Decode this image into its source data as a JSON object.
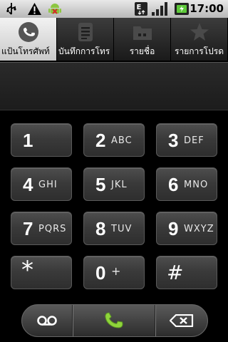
{
  "status_bar": {
    "time": "17:00",
    "icons": [
      "usb-icon",
      "warning-icon",
      "android-debug-icon",
      "data-transfer-icon",
      "signal-icon",
      "battery-charging-icon"
    ]
  },
  "tabs": [
    {
      "label": "แป้นโทรศัพท์",
      "icon": "phone-icon",
      "active": true
    },
    {
      "label": "บันทึกการโทร",
      "icon": "call-log-icon",
      "active": false
    },
    {
      "label": "รายชื่อ",
      "icon": "contacts-icon",
      "active": false
    },
    {
      "label": "รายการโปรด",
      "icon": "star-icon",
      "active": false
    }
  ],
  "digits_display": {
    "value": ""
  },
  "keypad": [
    {
      "digit": "1",
      "letters": ""
    },
    {
      "digit": "2",
      "letters": "ABC"
    },
    {
      "digit": "3",
      "letters": "DEF"
    },
    {
      "digit": "4",
      "letters": "GHI"
    },
    {
      "digit": "5",
      "letters": "JKL"
    },
    {
      "digit": "6",
      "letters": "MNO"
    },
    {
      "digit": "7",
      "letters": "PQRS"
    },
    {
      "digit": "8",
      "letters": "TUV"
    },
    {
      "digit": "9",
      "letters": "WXYZ"
    },
    {
      "digit": "*",
      "letters": ""
    },
    {
      "digit": "0",
      "letters": "+"
    },
    {
      "digit": "#",
      "letters": ""
    }
  ],
  "actions": {
    "voicemail_icon": "voicemail-icon",
    "call_icon": "phone-call-icon",
    "delete_icon": "backspace-icon"
  },
  "colors": {
    "call_green": "#8fd43b",
    "active_tab": "#e6e6e6"
  }
}
